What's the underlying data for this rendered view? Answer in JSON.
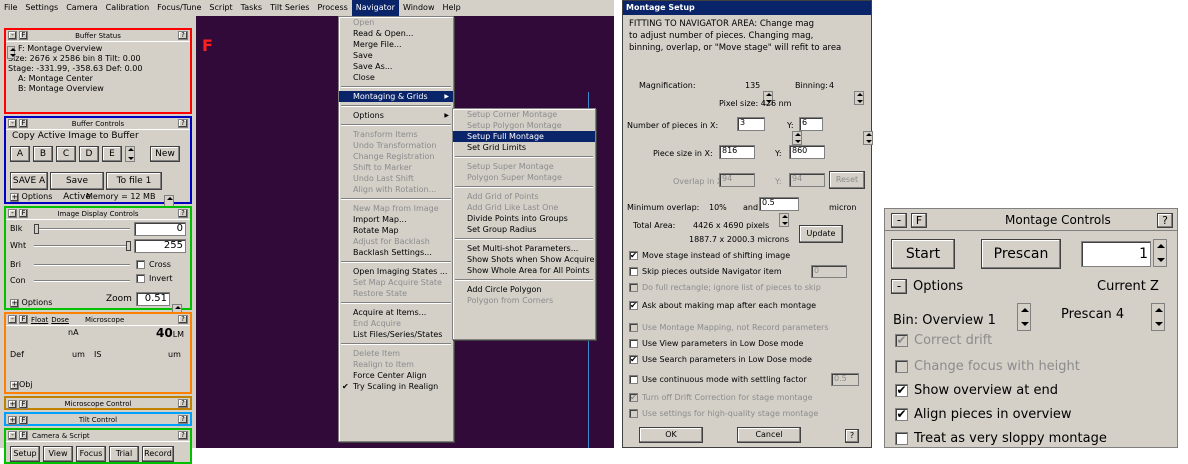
{
  "menubar": [
    "File",
    "Settings",
    "Camera",
    "Calibration",
    "Focus/Tune",
    "Script",
    "Tasks",
    "Tilt Series",
    "Process",
    "Navigator",
    "Window",
    "Help"
  ],
  "buffer_status": {
    "title": "Buffer Status",
    "help": "?",
    "minus": "-",
    "f": "F",
    "line1": "F: Montage Overview",
    "line2": "Size: 2676 x 2586  bin 8     Tilt: 0.00",
    "line3": "Stage: -331.99, -358.63     Def: 0.00",
    "line4": "A: Montage Center",
    "line5": "B: Montage Overview"
  },
  "buffer_controls": {
    "title": "Buffer Controls",
    "group": "Copy Active Image to Buffer",
    "buttons": [
      "A",
      "B",
      "C",
      "D",
      "E"
    ],
    "new": "New",
    "save_a": "SAVE A",
    "save_active": "Save Active",
    "to_file": "To file 1",
    "options": "Options",
    "memory": "Memory = 12 MB"
  },
  "image_display": {
    "title": "Image Display Controls",
    "blk": "Blk",
    "blk_val": "0",
    "wht": "Wht",
    "wht_val": "255",
    "bri": "Bri",
    "cross": "Cross",
    "con": "Con",
    "invert": "Invert",
    "zoom": "Zoom",
    "zoom_val": "0.51",
    "options": "Options"
  },
  "microscope": {
    "f": "F",
    "float": "Float",
    "dose": "Dose",
    "title": "Microscope",
    "na": "nA",
    "mag": "40",
    "lm": "LM",
    "def": "Def",
    "um1": "um",
    "is": "IS",
    "um2": "um",
    "obj": "Obj"
  },
  "microscope_control": {
    "title": "Microscope Control"
  },
  "tilt_control": {
    "title": "Tilt Control"
  },
  "camera_script": {
    "title": "Camera & Script",
    "buttons": [
      "Setup",
      "View",
      "Focus",
      "Trial",
      "Record"
    ]
  },
  "canvas": {
    "label": "F"
  },
  "navigator_menu": {
    "items": [
      {
        "label": "Open",
        "dis": true
      },
      {
        "label": "Read & Open...",
        "dis": false
      },
      {
        "label": "Merge File...",
        "dis": false
      },
      {
        "label": "Save",
        "dis": false
      },
      {
        "label": "Save As...",
        "dis": false
      },
      {
        "label": "Close",
        "dis": false
      },
      {
        "sep": true
      },
      {
        "label": "Montaging & Grids",
        "dis": false,
        "hl": true,
        "sub": true
      },
      {
        "sep": true
      },
      {
        "label": "Options",
        "dis": false,
        "sub": true
      },
      {
        "sep": true
      },
      {
        "label": "Transform Items",
        "dis": true
      },
      {
        "label": "Undo Transformation",
        "dis": true
      },
      {
        "label": "Change Registration",
        "dis": true
      },
      {
        "label": "Shift to Marker",
        "dis": true
      },
      {
        "label": "Undo Last Shift",
        "dis": true
      },
      {
        "label": "Align with Rotation...",
        "dis": true
      },
      {
        "sep": true
      },
      {
        "label": "New Map from Image",
        "dis": true
      },
      {
        "label": "Import Map...",
        "dis": false
      },
      {
        "label": "Rotate Map",
        "dis": false
      },
      {
        "label": "Adjust for Backlash",
        "dis": true
      },
      {
        "label": "Backlash Settings...",
        "dis": false
      },
      {
        "sep": true
      },
      {
        "label": "Open Imaging States ...",
        "dis": false
      },
      {
        "label": "Set Map Acquire State",
        "dis": true
      },
      {
        "label": "Restore State",
        "dis": true
      },
      {
        "sep": true
      },
      {
        "label": "Acquire at Items...",
        "dis": false
      },
      {
        "label": "End Acquire",
        "dis": true
      },
      {
        "label": "List Files/Series/States",
        "dis": false
      },
      {
        "sep": true
      },
      {
        "label": "Delete Item",
        "dis": true
      },
      {
        "label": "Realign to Item",
        "dis": true
      },
      {
        "label": "Force Center Align",
        "dis": false
      },
      {
        "label": "Try Scaling in Realign",
        "dis": false,
        "check": true
      }
    ]
  },
  "grids_submenu": {
    "items": [
      {
        "label": "Setup Corner Montage",
        "dis": true
      },
      {
        "label": "Setup Polygon Montage",
        "dis": true
      },
      {
        "label": "Setup Full Montage",
        "dis": false,
        "hl": true
      },
      {
        "label": "Set Grid Limits",
        "dis": false
      },
      {
        "sep": true
      },
      {
        "label": "Setup Super Montage",
        "dis": true
      },
      {
        "label": "Polygon Super Montage",
        "dis": true
      },
      {
        "sep": true
      },
      {
        "label": "Add Grid of Points",
        "dis": true
      },
      {
        "label": "Add Grid Like Last One",
        "dis": true
      },
      {
        "label": "Divide Points into Groups",
        "dis": false
      },
      {
        "label": "Set Group Radius",
        "dis": false
      },
      {
        "sep": true
      },
      {
        "label": "Set Multi-shot Parameters...",
        "dis": false
      },
      {
        "label": "Show Shots when Show Acquire",
        "dis": false
      },
      {
        "label": "Show Whole Area for All Points",
        "dis": false
      },
      {
        "sep": true
      },
      {
        "label": "Add Circle Polygon",
        "dis": false
      },
      {
        "label": "Polygon from Corners",
        "dis": true
      }
    ]
  },
  "montage_setup": {
    "title": "Montage Setup",
    "intro1": "FITTING TO NAVIGATOR AREA: Change mag",
    "intro2": "to adjust number of pieces.  Changing mag,",
    "intro3": "binning, overlap, or \"Move stage\" will refit to area",
    "magnification_label": "Magnification:",
    "magnification": "135",
    "binning_label": "Binning:",
    "binning": "4",
    "pixel_size": "Pixel size: 426 nm",
    "num_pieces_label": "Number of pieces in X:",
    "pieces_x": "3",
    "y_label": "Y:",
    "pieces_y": "6",
    "piece_size_label": "Piece size in X:",
    "piece_x": "816",
    "piece_y": "860",
    "overlap_label": "Overlap in X:",
    "overlap_x": "94",
    "overlap_y": "94",
    "reset": "Reset",
    "min_overlap_label": "Minimum overlap:",
    "min_overlap": "10%",
    "and": "and",
    "min_overlap_um": "0.5",
    "micron": "micron",
    "total_area_label": "Total Area:",
    "total_pixels": "4426 x 4690 pixels",
    "total_microns": "1887.7 x 2000.3 microns",
    "update": "Update",
    "options": [
      {
        "label": "Move stage instead of shifting image",
        "checked": true,
        "dis": false
      },
      {
        "label": "Skip pieces outside Navigator item",
        "checked": false,
        "dis": false,
        "field": "0"
      },
      {
        "label": "Do full rectangle; ignore list of pieces to skip",
        "checked": false,
        "dis": true
      },
      {
        "label": "Ask about making map after each montage",
        "checked": true,
        "dis": false
      },
      {
        "label": "Use Montage Mapping, not Record parameters",
        "checked": false,
        "dis": true
      },
      {
        "label": "Use View parameters in Low Dose mode",
        "checked": false,
        "dis": false
      },
      {
        "label": "Use Search parameters in Low Dose mode",
        "checked": true,
        "dis": false
      },
      {
        "label": "Use continuous mode with settling factor",
        "checked": false,
        "dis": false,
        "field": "0.5"
      },
      {
        "label": "Turn off Drift Correction for stage montage",
        "checked": true,
        "dis": true
      },
      {
        "label": "Use settings for high-quality stage montage",
        "checked": false,
        "dis": true
      }
    ],
    "ok": "OK",
    "cancel": "Cancel",
    "help": "?"
  },
  "montage_controls": {
    "title": "Montage Controls",
    "minus": "-",
    "f": "F",
    "help": "?",
    "start": "Start",
    "prescan": "Prescan",
    "z_value": "1",
    "options": "Options",
    "current_z": "Current Z",
    "bin_label": "Bin: Overview 1",
    "prescan_bin": "Prescan 4",
    "checks": [
      {
        "label": "Correct drift",
        "checked": true,
        "dis": true
      },
      {
        "label": "Change focus with height",
        "checked": false,
        "dis": true
      },
      {
        "label": "Show overview at end",
        "checked": true,
        "dis": false
      },
      {
        "label": "Align pieces in overview",
        "checked": true,
        "dis": false
      },
      {
        "label": "Treat as very sloppy montage",
        "checked": false,
        "dis": false
      }
    ]
  }
}
